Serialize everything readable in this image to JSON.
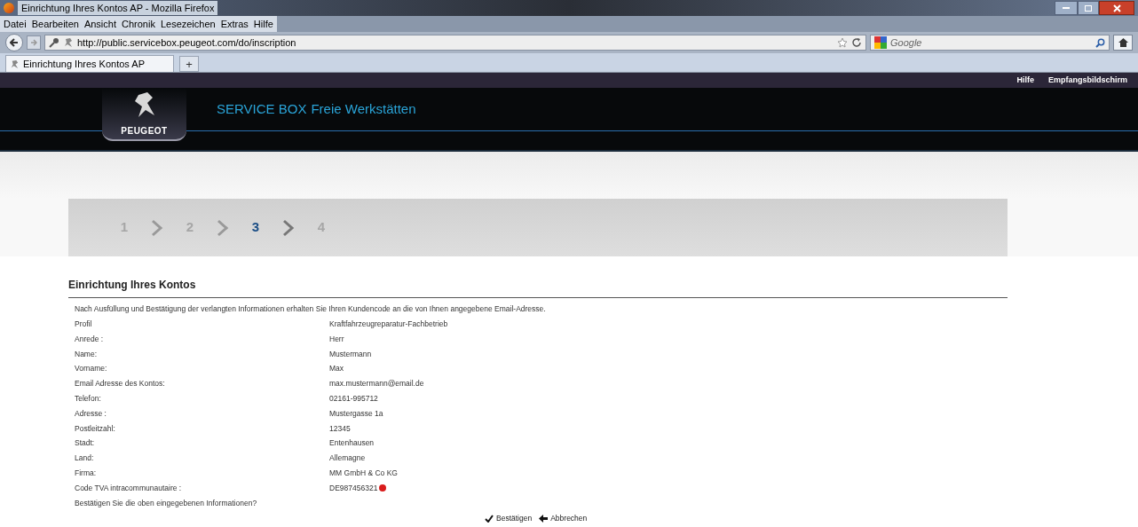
{
  "window": {
    "title": "Einrichtung Ihres Kontos AP - Mozilla Firefox"
  },
  "menu": [
    "Datei",
    "Bearbeiten",
    "Ansicht",
    "Chronik",
    "Lesezeichen",
    "Extras",
    "Hilfe"
  ],
  "address_bar": {
    "value": "http://public.servicebox.peugeot.com/do/inscription"
  },
  "search_bar": {
    "placeholder": "Google"
  },
  "tabs": [
    {
      "label": "Einrichtung Ihres Kontos AP",
      "selected": true
    }
  ],
  "new_tab": "+",
  "top_links": [
    "Hilfe",
    "Empfangsbildschirm"
  ],
  "header": {
    "logo_text": "PEUGEOT",
    "title": "SERVICE BOX",
    "subtitle": "Freie Werkstätten"
  },
  "steps": [
    {
      "label": "1",
      "selected": false
    },
    {
      "label": "2",
      "selected": false
    },
    {
      "label": "3",
      "selected": true
    },
    {
      "label": "4",
      "selected": false
    }
  ],
  "section": {
    "title": "Einrichtung Ihres Kontos",
    "intro": "Nach Ausfüllung und Bestätigung der verlangten Informationen erhalten Sie Ihren Kundencode an die von Ihnen angegebene Email-Adresse."
  },
  "fields": [
    {
      "label": "Profil",
      "value": "Kraftfahrzeugreparatur-Fachbetrieb"
    },
    {
      "label": "Anrede :",
      "value": "Herr"
    },
    {
      "label": "Name:",
      "value": "Mustermann"
    },
    {
      "label": "Vorname:",
      "value": "Max"
    },
    {
      "label": "Email Adresse des Kontos:",
      "value": "max.mustermann@email.de"
    },
    {
      "label": "Telefon:",
      "value": "02161-995712"
    },
    {
      "label": "Adresse :",
      "value": "Mustergasse 1a"
    },
    {
      "label": "Postleitzahl:",
      "value": "12345"
    },
    {
      "label": "Stadt:",
      "value": "Entenhausen"
    },
    {
      "label": "Land:",
      "value": "Allemagne"
    },
    {
      "label": "Firma:",
      "value": "MM GmbH & Co KG"
    },
    {
      "label": "Code TVA intracommunautaire :",
      "value": "DE987456321",
      "color": "#d91c1c"
    }
  ],
  "question": "Bestätigen Sie die oben eingegebenen Informationen?",
  "actions": [
    {
      "kind": "confirm",
      "label": "Bestätigen"
    },
    {
      "kind": "cancel",
      "label": "Abbrechen"
    }
  ]
}
